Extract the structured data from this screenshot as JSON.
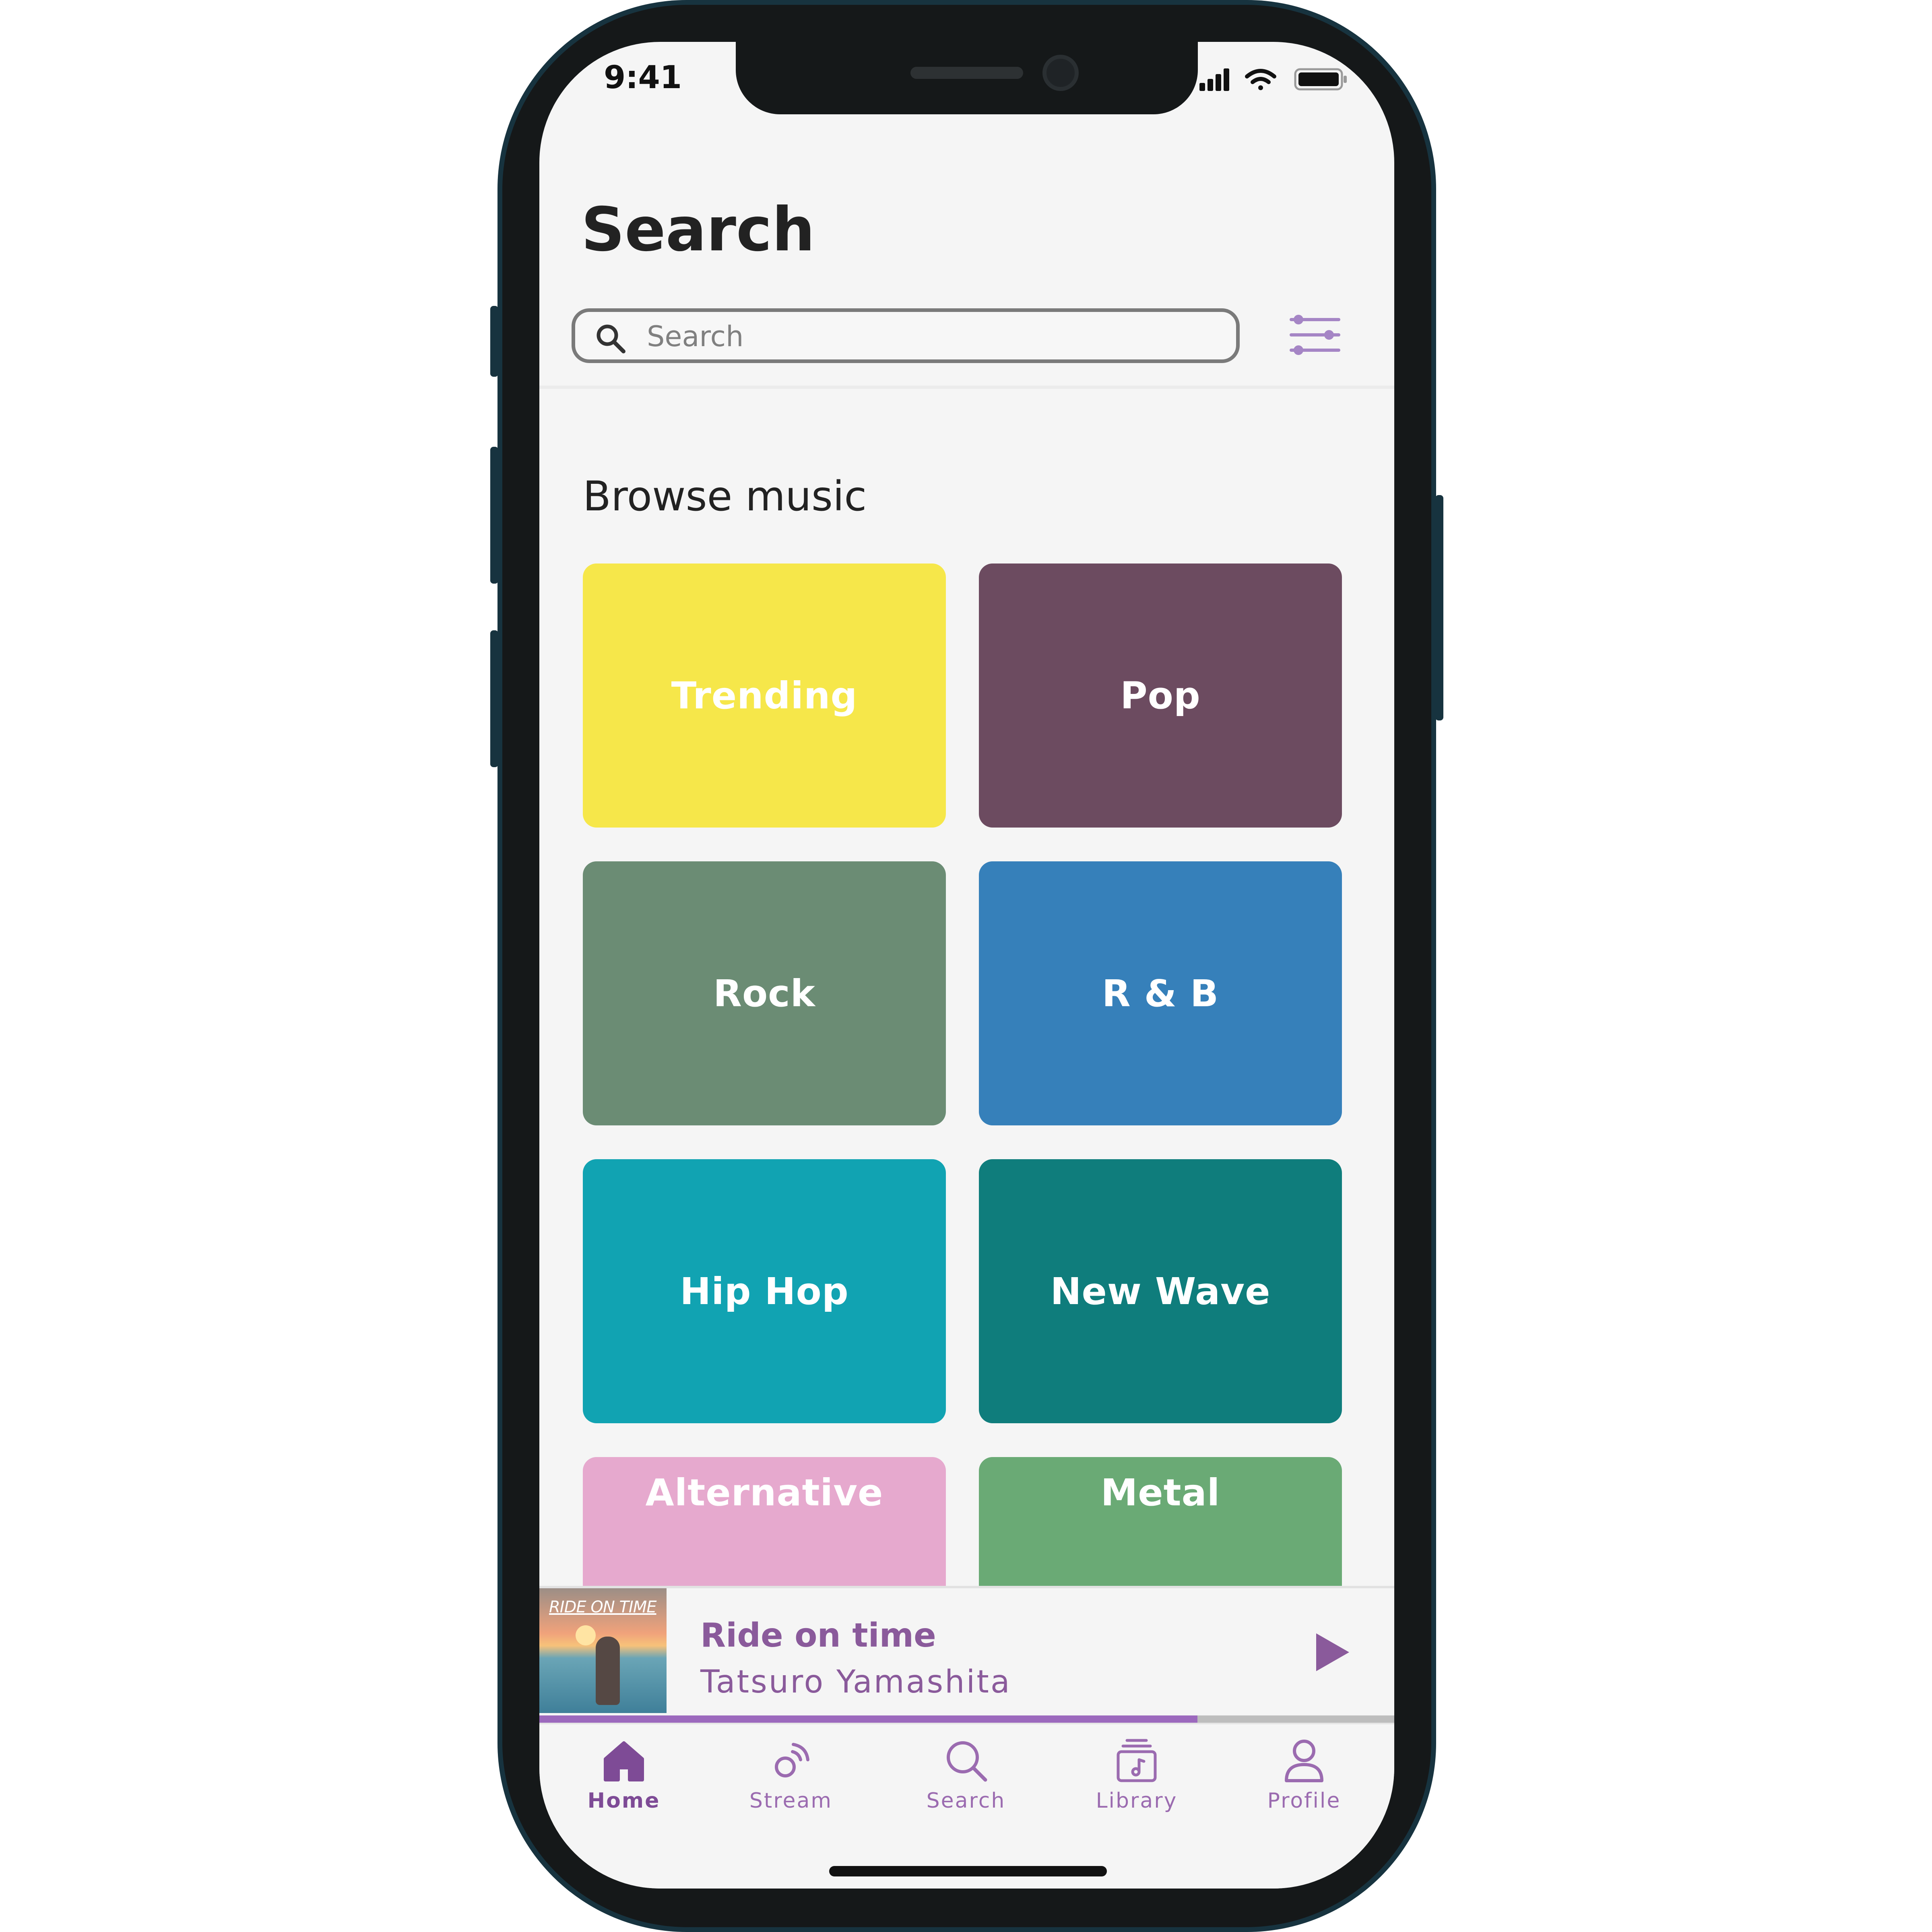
{
  "status_bar": {
    "time": "9:41"
  },
  "header": {
    "title": "Search"
  },
  "search": {
    "placeholder": "Search"
  },
  "browse": {
    "title": "Browse music",
    "tiles": [
      {
        "label": "Trending",
        "color": "#f6e74a"
      },
      {
        "label": "Pop",
        "color": "#6c4b60"
      },
      {
        "label": "Rock",
        "color": "#6b8c74"
      },
      {
        "label": "R & B",
        "color": "#3680ba"
      },
      {
        "label": "Hip Hop",
        "color": "#11a3b2"
      },
      {
        "label": "New Wave",
        "color": "#0f7d7c"
      },
      {
        "label": "Alternative",
        "color": "#e6a9ce"
      },
      {
        "label": "Metal",
        "color": "#6aaa75"
      }
    ]
  },
  "now_playing": {
    "album_text": "RIDE ON TIME",
    "title": "Ride on time",
    "artist": "Tatsuro Yamashita",
    "progress": 0.77,
    "accent": "#8a5a9b"
  },
  "nav": {
    "items": [
      {
        "label": "Home",
        "icon": "home-icon",
        "active": true
      },
      {
        "label": "Stream",
        "icon": "stream-icon",
        "active": false
      },
      {
        "label": "Search",
        "icon": "search-icon",
        "active": false
      },
      {
        "label": "Library",
        "icon": "library-icon",
        "active": false
      },
      {
        "label": "Profile",
        "icon": "profile-icon",
        "active": false
      }
    ]
  }
}
